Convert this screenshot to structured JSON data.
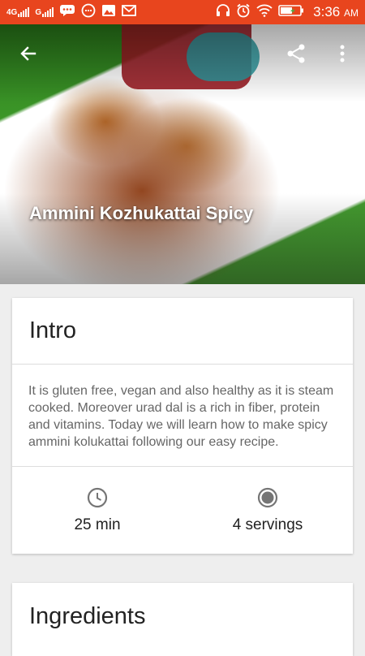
{
  "status_bar": {
    "network1": "4G",
    "network2": "G",
    "time": "3:36",
    "ampm": "AM"
  },
  "hero": {
    "title": "Ammini Kozhukattai Spicy"
  },
  "intro": {
    "heading": "Intro",
    "text": "It is gluten free, vegan and also healthy as it is steam cooked. Moreover urad dal is a rich in fiber, protein and vitamins. Today we will learn how to make spicy ammini kolukattai following our easy recipe.",
    "time": "25 min",
    "servings": "4 servings"
  },
  "ingredients": {
    "heading": "Ingredients"
  },
  "icons": {
    "back": "arrow-back-icon",
    "share": "share-icon",
    "more": "more-vert-icon",
    "clock": "clock-icon",
    "servings": "servings-icon"
  },
  "colors": {
    "status_bar": "#e8451e",
    "background": "#eeeeee",
    "card": "#ffffff"
  }
}
